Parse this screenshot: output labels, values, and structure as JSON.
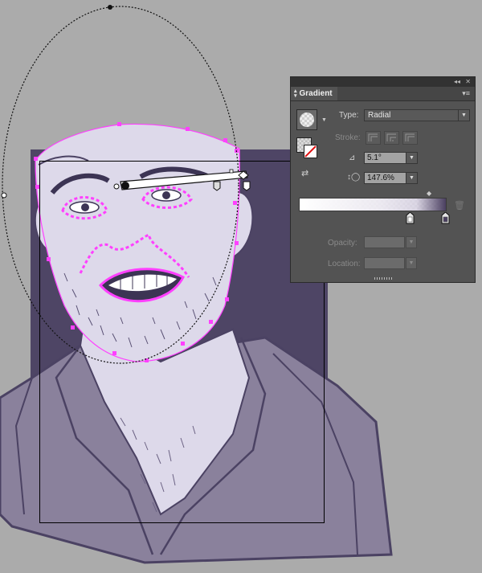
{
  "panel": {
    "title": "Gradient",
    "collapse_icon": "double-chevron-icon",
    "close_icon": "close-icon",
    "menu_icon": "panel-menu-icon",
    "type_label": "Type:",
    "type_value": "Radial",
    "stroke_label": "Stroke:",
    "angle_value": "5.1°",
    "aspect_value": "147.6%",
    "opacity_label": "Opacity:",
    "location_label": "Location:",
    "gradient_end_color": "#4a3f60"
  },
  "canvas": {
    "background_color": "#ababab",
    "artwork_bg_color": "#4e4565",
    "shirt_color": "#8a819c",
    "skin_color": "#ddd9ea",
    "selection_color": "#ff40ff"
  }
}
